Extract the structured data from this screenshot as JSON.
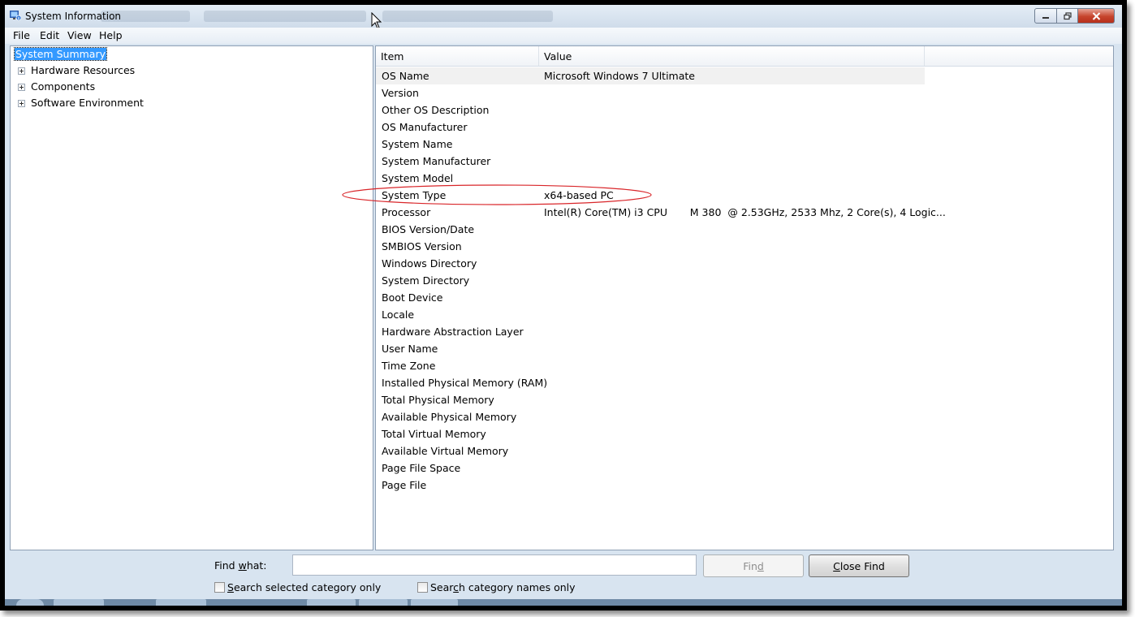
{
  "window": {
    "title": "System Information"
  },
  "menu": [
    "File",
    "Edit",
    "View",
    "Help"
  ],
  "tree": [
    {
      "label": "System Summary",
      "selected": true
    },
    {
      "label": "Hardware Resources"
    },
    {
      "label": "Components"
    },
    {
      "label": "Software Environment"
    }
  ],
  "list": {
    "columns": [
      "Item",
      "Value"
    ],
    "rows": [
      {
        "item": "OS Name",
        "value": "Microsoft Windows 7 Ultimate"
      },
      {
        "item": "Version",
        "value": ""
      },
      {
        "item": "Other OS Description",
        "value": ""
      },
      {
        "item": "OS Manufacturer",
        "value": ""
      },
      {
        "item": "System Name",
        "value": ""
      },
      {
        "item": "System Manufacturer",
        "value": ""
      },
      {
        "item": "System Model",
        "value": ""
      },
      {
        "item": "System Type",
        "value": "x64-based PC"
      },
      {
        "item": "Processor",
        "value": "Intel(R) Core(TM) i3 CPU       M 380  @ 2.53GHz, 2533 Mhz, 2 Core(s), 4 Logic..."
      },
      {
        "item": "BIOS Version/Date",
        "value": ""
      },
      {
        "item": "SMBIOS Version",
        "value": ""
      },
      {
        "item": "Windows Directory",
        "value": ""
      },
      {
        "item": "System Directory",
        "value": ""
      },
      {
        "item": "Boot Device",
        "value": ""
      },
      {
        "item": "Locale",
        "value": ""
      },
      {
        "item": "Hardware Abstraction Layer",
        "value": ""
      },
      {
        "item": "User Name",
        "value": ""
      },
      {
        "item": "Time Zone",
        "value": ""
      },
      {
        "item": "Installed Physical Memory (RAM)",
        "value": ""
      },
      {
        "item": "Total Physical Memory",
        "value": ""
      },
      {
        "item": "Available Physical Memory",
        "value": ""
      },
      {
        "item": "Total Virtual Memory",
        "value": ""
      },
      {
        "item": "Available Virtual Memory",
        "value": ""
      },
      {
        "item": "Page File Space",
        "value": ""
      },
      {
        "item": "Page File",
        "value": ""
      }
    ]
  },
  "find": {
    "label_pre": "Find ",
    "label_key": "w",
    "label_post": "hat:",
    "input_value": "",
    "find_btn": {
      "pre": "Fin",
      "key": "d",
      "post": ""
    },
    "close_btn": {
      "pre": "",
      "key": "C",
      "post": "lose Find"
    },
    "chk_selected": {
      "pre": "",
      "key": "S",
      "post": "earch selected category only",
      "checked": false
    },
    "chk_names": {
      "pre": "Sear",
      "key": "c",
      "post": "h category names only",
      "checked": false
    }
  },
  "annotation": {
    "color": "#d9262a"
  },
  "icons": {
    "app": "system-info-icon",
    "expand": "plus-expander-icon",
    "cursor": "mouse-pointer-icon"
  }
}
